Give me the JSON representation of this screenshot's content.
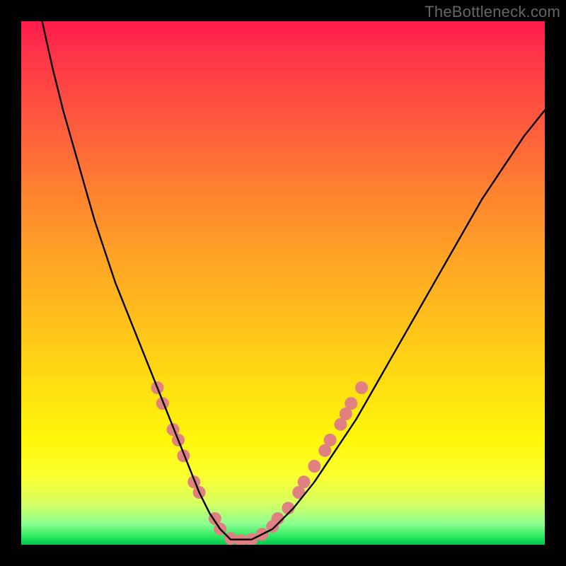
{
  "watermark": "TheBottleneck.com",
  "chart_data": {
    "type": "line",
    "title": "",
    "xlabel": "",
    "ylabel": "",
    "xlim": [
      0,
      100
    ],
    "ylim": [
      0,
      100
    ],
    "grid": false,
    "legend": false,
    "series": [
      {
        "name": "bottleneck-curve",
        "color": "#000000",
        "x": [
          4,
          6,
          8,
          10,
          12,
          14,
          16,
          18,
          20,
          22,
          24,
          26,
          28,
          30,
          32,
          34,
          36,
          38,
          40,
          44,
          48,
          52,
          56,
          60,
          64,
          68,
          72,
          76,
          80,
          84,
          88,
          92,
          96,
          100
        ],
        "y": [
          100,
          91,
          83,
          76,
          69,
          62,
          56,
          50,
          45,
          40,
          35,
          30,
          25,
          20,
          15,
          10,
          6,
          3,
          1,
          1,
          3,
          7,
          12,
          18,
          24,
          31,
          38,
          45,
          52,
          59,
          66,
          72,
          78,
          83
        ]
      }
    ],
    "markers": {
      "name": "highlighted-points",
      "color": "#e08080",
      "radius_px": 9,
      "points": [
        {
          "x": 26,
          "y": 30
        },
        {
          "x": 27,
          "y": 27
        },
        {
          "x": 29,
          "y": 22
        },
        {
          "x": 30,
          "y": 20
        },
        {
          "x": 31,
          "y": 17
        },
        {
          "x": 33,
          "y": 12
        },
        {
          "x": 34,
          "y": 10
        },
        {
          "x": 37,
          "y": 5
        },
        {
          "x": 38,
          "y": 3
        },
        {
          "x": 40,
          "y": 1.2
        },
        {
          "x": 42,
          "y": 0.8
        },
        {
          "x": 44,
          "y": 1
        },
        {
          "x": 46,
          "y": 2
        },
        {
          "x": 48,
          "y": 3.5
        },
        {
          "x": 49,
          "y": 5
        },
        {
          "x": 51,
          "y": 7
        },
        {
          "x": 53,
          "y": 10
        },
        {
          "x": 54,
          "y": 12
        },
        {
          "x": 56,
          "y": 15
        },
        {
          "x": 58,
          "y": 18
        },
        {
          "x": 59,
          "y": 20
        },
        {
          "x": 61,
          "y": 23
        },
        {
          "x": 62,
          "y": 25
        },
        {
          "x": 63,
          "y": 27
        },
        {
          "x": 65,
          "y": 30
        }
      ]
    }
  }
}
